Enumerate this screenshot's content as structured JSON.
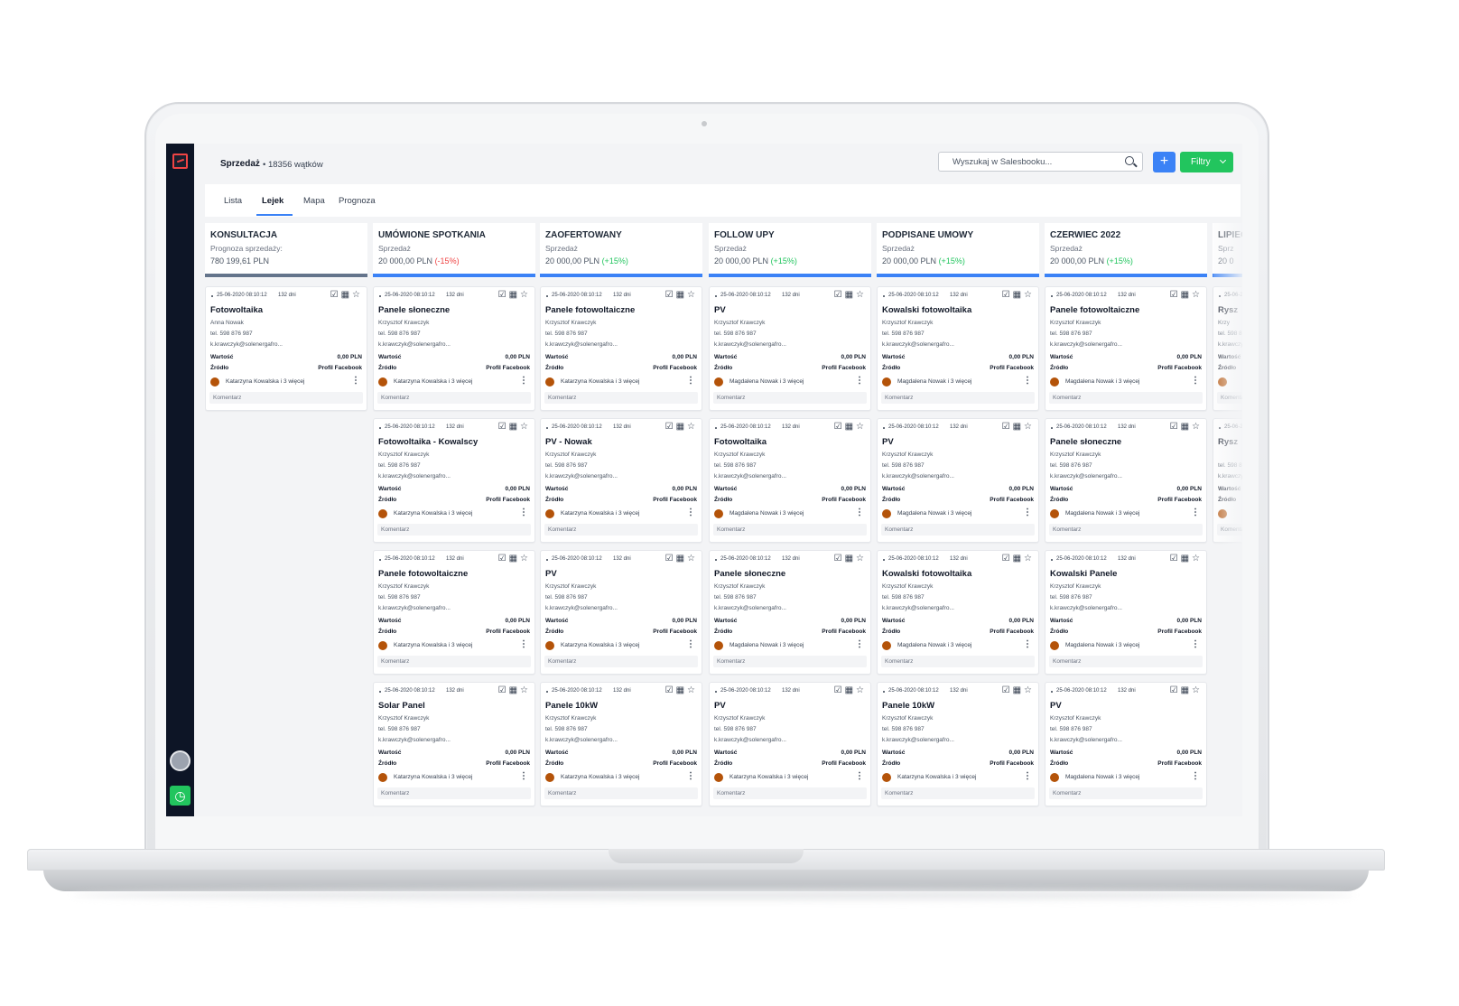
{
  "app": {
    "section_title": "Sprzedaż",
    "subtitle": "• 18356 wątków",
    "search_placeholder": "Wyszukaj w Salesbooku...",
    "add_label": "+",
    "filters_label": "Filtry"
  },
  "tabs": [
    "Lista",
    "Lejek",
    "Mapa",
    "Prognoza"
  ],
  "active_tab": "Lejek",
  "colors": {
    "accent": "#3b82f6",
    "success": "#22c55e",
    "danger": "#ef4444",
    "sidebar": "#0d1526"
  },
  "card_labels": {
    "value": "Wartość",
    "source": "Źródło",
    "comment": "Komentarz",
    "date": "25-06-2020 08:10:12",
    "days": "132 dni",
    "person": "Krzysztof Krawczyk",
    "phone": "tel. 598 876 987",
    "email": "k.krawczyk@solenergafro...",
    "amount": "0,00 PLN",
    "source_value": "Profil Facebook",
    "owner_kk": "Katarzyna Kowalska i 3 więcej",
    "owner_mn": "Magdalena Nowak i 3 więcej"
  },
  "columns": [
    {
      "title": "KONSULTACJA",
      "subtitle": "Prognoza sprzedaży:",
      "value": "780 199,61 PLN",
      "change": "",
      "cards": [
        {
          "title": "Fotowoltaika",
          "person": "Anna Nowak",
          "owner": "Katarzyna Kowalska i 3 więcej"
        }
      ]
    },
    {
      "title": "UMÓWIONE SPOTKANIA",
      "subtitle": "Sprzedaż",
      "value": "20 000,00 PLN",
      "change": "(-15%)",
      "cards": [
        {
          "title": "Panele słoneczne",
          "person": "Krzysztof Krawczyk",
          "owner": "Katarzyna Kowalska i 3 więcej"
        },
        {
          "title": "Fotowoltaika - Kowalscy",
          "person": "Krzysztof Krawczyk",
          "owner": "Katarzyna Kowalska i 3 więcej"
        },
        {
          "title": "Panele fotowoltaiczne",
          "person": "Krzysztof Krawczyk",
          "owner": "Katarzyna Kowalska i 3 więcej"
        },
        {
          "title": "Solar Panel",
          "person": "Krzysztof Krawczyk",
          "owner": "Katarzyna Kowalska i 3 więcej"
        }
      ]
    },
    {
      "title": "ZAOFERTOWANY",
      "subtitle": "Sprzedaż",
      "value": "20 000,00 PLN",
      "change": "(+15%)",
      "cards": [
        {
          "title": "Panele fotowoltaiczne",
          "person": "Krzysztof Krawczyk",
          "owner": "Katarzyna Kowalska i 3 więcej"
        },
        {
          "title": "PV - Nowak",
          "person": "Krzysztof Krawczyk",
          "owner": "Katarzyna Kowalska i 3 więcej"
        },
        {
          "title": "PV",
          "person": "Krzysztof Krawczyk",
          "owner": "Katarzyna Kowalska i 3 więcej"
        },
        {
          "title": "Panele 10kW",
          "person": "Krzysztof Krawczyk",
          "owner": "Katarzyna Kowalska i 3 więcej"
        }
      ]
    },
    {
      "title": "FOLLOW UPY",
      "subtitle": "Sprzedaż",
      "value": "20 000,00 PLN",
      "change": "(+15%)",
      "cards": [
        {
          "title": "PV",
          "person": "Krzysztof Krawczyk",
          "owner": "Magdalena Nowak i 3 więcej"
        },
        {
          "title": "Fotowoltaika",
          "person": "Krzysztof Krawczyk",
          "owner": "Magdalena Nowak i 3 więcej"
        },
        {
          "title": "Panele słoneczne",
          "person": "Krzysztof Krawczyk",
          "owner": "Magdalena Nowak i 3 więcej"
        },
        {
          "title": "PV",
          "person": "Krzysztof Krawczyk",
          "owner": "Katarzyna Kowalska i 3 więcej"
        }
      ]
    },
    {
      "title": "PODPISANE UMOWY",
      "subtitle": "Sprzedaż",
      "value": "20 000,00 PLN",
      "change": "(+15%)",
      "cards": [
        {
          "title": "Kowalski fotowoltaika",
          "person": "Krzysztof Krawczyk",
          "owner": "Magdalena Nowak i 3 więcej"
        },
        {
          "title": "PV",
          "person": "Krzysztof Krawczyk",
          "owner": "Magdalena Nowak i 3 więcej"
        },
        {
          "title": "Kowalski fotowoltaika",
          "person": "Krzysztof Krawczyk",
          "owner": "Magdalena Nowak i 3 więcej"
        },
        {
          "title": "Panele 10kW",
          "person": "Krzysztof Krawczyk",
          "owner": "Katarzyna Kowalska i 3 więcej"
        }
      ]
    },
    {
      "title": "CZERWIEC 2022",
      "subtitle": "Sprzedaż",
      "value": "20 000,00 PLN",
      "change": "(+15%)",
      "cards": [
        {
          "title": "Panele fotowoltaiczne",
          "person": "Krzysztof Krawczyk",
          "owner": "Magdalena Nowak i 3 więcej"
        },
        {
          "title": "Panele słoneczne",
          "person": "Krzysztof Krawczyk",
          "owner": "Magdalena Nowak i 3 więcej"
        },
        {
          "title": "Kowalski Panele",
          "person": "Krzysztof Krawczyk",
          "owner": "Magdalena Nowak i 3 więcej"
        },
        {
          "title": "PV",
          "person": "Krzysztof Krawczyk",
          "owner": "Magdalena Nowak i 3 więcej"
        }
      ]
    },
    {
      "title": "LIPIEC",
      "subtitle": "Sprz",
      "value": "20 0",
      "change": "",
      "cards": [
        {
          "title": "Rysz",
          "person": "Krzy",
          "owner": ""
        },
        {
          "title": "Rysz",
          "person": "",
          "owner": ""
        }
      ]
    }
  ]
}
